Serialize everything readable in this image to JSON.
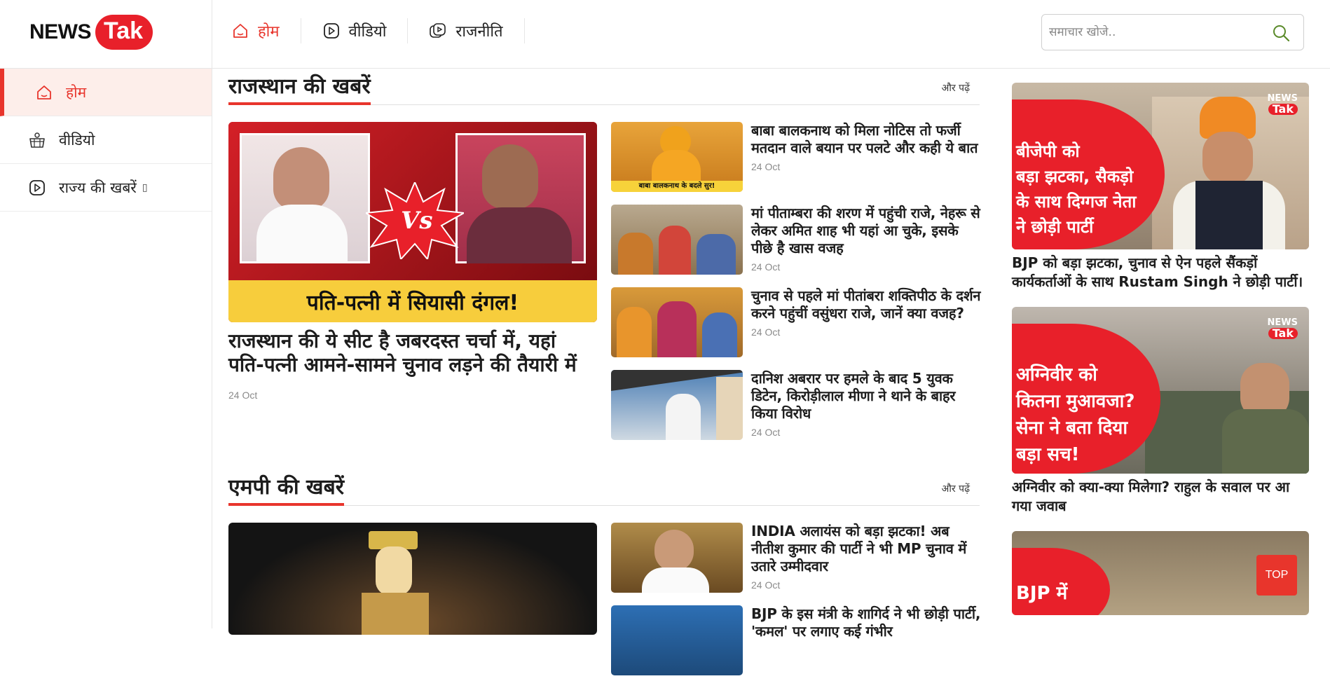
{
  "header": {
    "logo_news": "NEWS",
    "logo_tak": "Tak",
    "nav": [
      {
        "label": "होम",
        "icon": "home-icon",
        "active": true
      },
      {
        "label": "वीडियो",
        "icon": "play-icon",
        "active": false
      },
      {
        "label": "राजनीति",
        "icon": "politics-play-icon",
        "active": false
      }
    ],
    "search": {
      "placeholder": "समाचार खोजे.."
    }
  },
  "sidebar": {
    "items": [
      {
        "label": "होम",
        "icon": "home-icon",
        "active": true
      },
      {
        "label": "वीडियो",
        "icon": "video-basket-icon",
        "active": false
      },
      {
        "label": "राज्य की खबरें",
        "icon": "play-icon",
        "active": false,
        "suffix": "▯"
      }
    ]
  },
  "sections": [
    {
      "title": "राजस्थान की खबरें",
      "more": "और पढ़ें",
      "lead": {
        "image_caption": "पति-पत्नी में सियासी दंगल!",
        "title": "राजस्थान की ये सीट है जबरदस्त चर्चा में, यहां पति-पत्नी आमने-सामने चुनाव लड़ने की तैयारी में",
        "date": "24 Oct"
      },
      "stories": [
        {
          "title": "बाबा बालकनाथ को मिला नोटिस तो फर्जी मतदान वाले बयान पर पलटे और कही ये बात",
          "date": "24 Oct",
          "thumb_caption": "बाबा बालकनाथ के बदले सुर!"
        },
        {
          "title": "मां पीताम्बरा की शरण में पहुंची राजे, नेहरू से लेकर अमित शाह भी यहां आ चुके, इसके पीछे है खास वजह",
          "date": "24 Oct"
        },
        {
          "title": "चुनाव से पहले मां पीतांबरा शक्तिपीठ के दर्शन करने पहुंचीं वसुंधरा राजे, जानें क्या वजह?",
          "date": "24 Oct"
        },
        {
          "title": "दानिश अबरार पर हमले के बाद 5 युवक डिटेन, किरोड़ीलाल मीणा ने थाने के बाहर किया विरोध",
          "date": "24 Oct"
        }
      ]
    },
    {
      "title": "एमपी की खबरें",
      "more": "और पढ़ें",
      "stories": [
        {
          "title": "INDIA अलायंस को बड़ा झटका! अब नीतीश कुमार की पार्टी ने भी MP चुनाव में उतारे उम्मीदवार",
          "date": "24 Oct"
        },
        {
          "title": "BJP के इस मंत्री के शागिर्द ने भी छोड़ी पार्टी, 'कमल' पर लगाए कई गंभीर",
          "date": ""
        }
      ]
    }
  ],
  "right": {
    "cards": [
      {
        "overlay": [
          "बीजेपी को",
          "बड़ा झटका, सैकड़ो",
          "के साथ दिग्गज नेता",
          "ने छोड़ी पार्टी"
        ],
        "title": "BJP को बड़ा झटका, चुनाव से ऐन पहले सैंकड़ों कार्यकर्ताओं के साथ Rustam Singh ने छोड़ी पार्टी।"
      },
      {
        "overlay": [
          "अग्निवीर को",
          "कितना मुआवजा?",
          "सेना ने बता दिया",
          "बड़ा सच!"
        ],
        "title": "अग्निवीर को क्या-क्या मिलेगा? राहुल के सवाल पर आ गया जवाब"
      },
      {
        "overlay": [
          "BJP में"
        ],
        "title": ""
      }
    ],
    "watermark_news": "NEWS",
    "watermark_tak": "Tak"
  },
  "top_button": "TOP",
  "colors": {
    "accent": "#e8352c",
    "brand_red": "#e8202a",
    "active_bg": "#fdeeea"
  }
}
